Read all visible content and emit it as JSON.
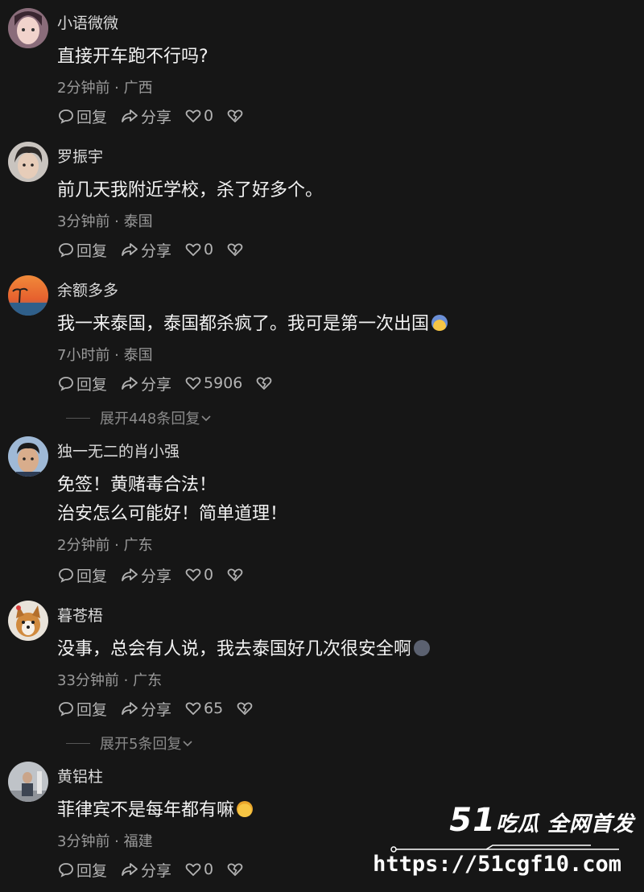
{
  "comments": [
    {
      "username": "小语微微",
      "lines": [
        "直接开车跑不行吗?"
      ],
      "meta": "2分钟前 · 广西",
      "reply": "回复",
      "share": "分享",
      "likes": "0"
    },
    {
      "username": "罗振宇",
      "lines": [
        "前几天我附近学校，杀了好多个。"
      ],
      "meta": "3分钟前 · 泰国",
      "reply": "回复",
      "share": "分享",
      "likes": "0"
    },
    {
      "username": "余额多多",
      "lines": [
        "我一来泰国，泰国都杀疯了。我可是第一次出国"
      ],
      "emoji": "scared-face-emoji",
      "meta": "7小时前 · 泰国",
      "reply": "回复",
      "share": "分享",
      "likes": "5906",
      "expand": "展开448条回复"
    },
    {
      "username": "独一无二的肖小强",
      "lines": [
        "免签！黄赌毒合法！",
        "治安怎么可能好！简单道理！"
      ],
      "meta": "2分钟前 · 广东",
      "reply": "回复",
      "share": "分享",
      "likes": "0"
    },
    {
      "username": "暮苍梧",
      "lines": [
        "没事，总会有人说，我去泰国好几次很安全啊"
      ],
      "emoji": "dizzy-face-emoji",
      "meta": "33分钟前 · 广东",
      "reply": "回复",
      "share": "分享",
      "likes": "65",
      "expand": "展开5条回复"
    },
    {
      "username": "黄铝柱",
      "lines": [
        "菲律宾不是每年都有嘛"
      ],
      "emoji": "crying-laughing-emoji",
      "meta": "3分钟前 · 福建",
      "reply": "回复",
      "share": "分享",
      "likes": "0"
    }
  ],
  "watermark": {
    "brand_number": "51",
    "brand_text": "吃瓜 全网首发",
    "url": "https://51cgf10.com"
  },
  "colors": {
    "background": "#161616",
    "primary_text": "#f2f2f2",
    "secondary_text": "#9a9a9a"
  }
}
